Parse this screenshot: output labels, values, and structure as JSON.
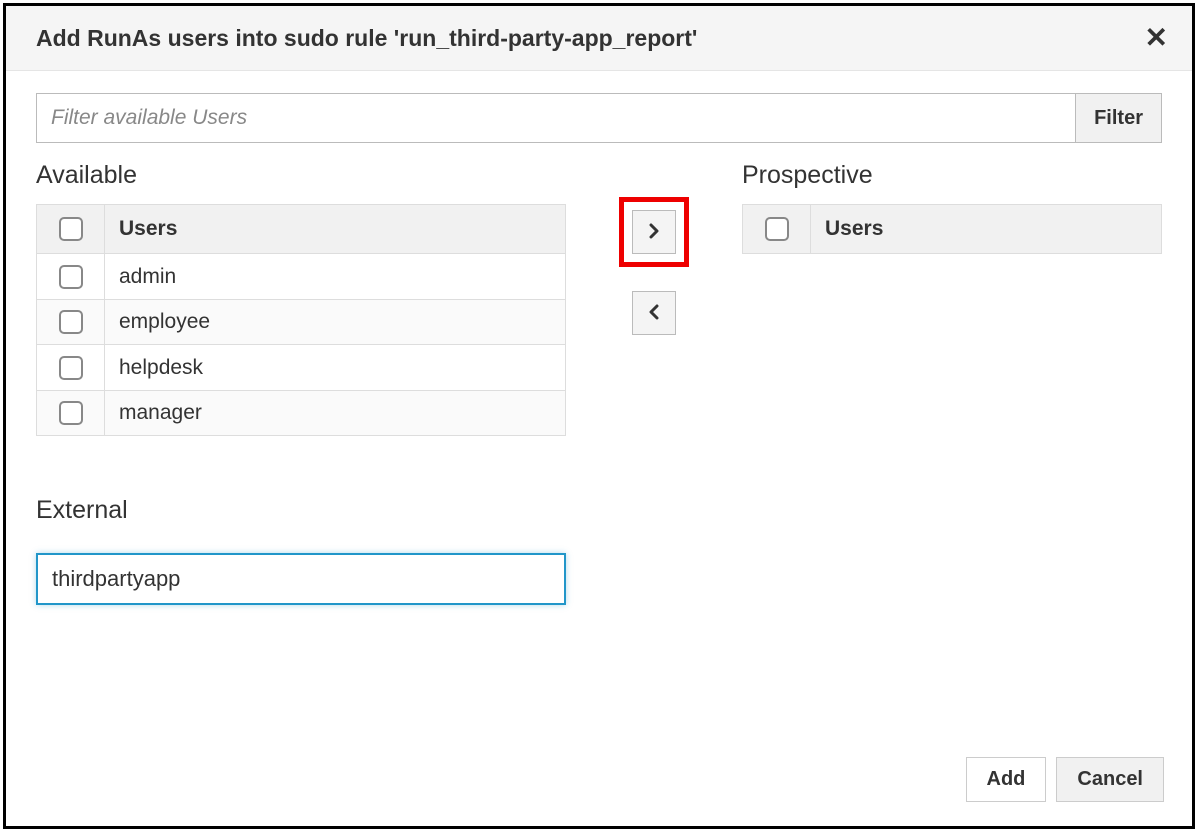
{
  "dialog": {
    "title": "Add RunAs users into sudo rule 'run_third-party-app_report'"
  },
  "filter": {
    "placeholder": "Filter available Users",
    "button_label": "Filter"
  },
  "available": {
    "heading": "Available",
    "column_header": "Users",
    "rows": [
      {
        "name": "admin"
      },
      {
        "name": "employee"
      },
      {
        "name": "helpdesk"
      },
      {
        "name": "manager"
      }
    ]
  },
  "prospective": {
    "heading": "Prospective",
    "column_header": "Users",
    "rows": []
  },
  "external": {
    "heading": "External",
    "value": "thirdpartyapp"
  },
  "footer": {
    "add_label": "Add",
    "cancel_label": "Cancel"
  }
}
